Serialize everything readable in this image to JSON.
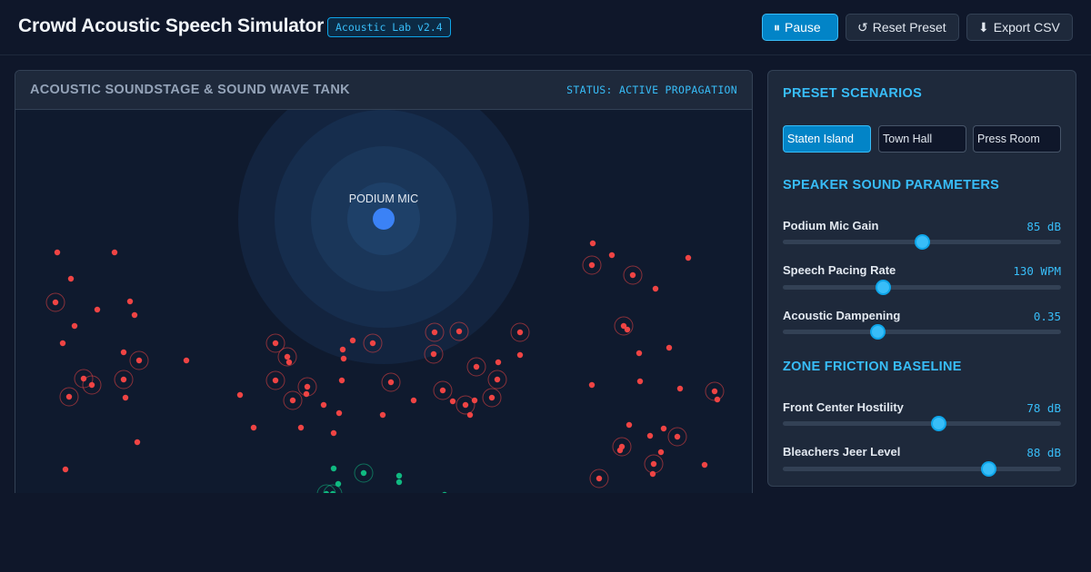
{
  "header": {
    "title": "Crowd Acoustic Speech Simulator",
    "version": "Acoustic Lab v2.4",
    "pause_label": "Pause",
    "pause_icon": "⏸",
    "reset_label": "Reset Preset",
    "reset_icon": "↺",
    "export_label": "Export CSV",
    "export_icon": "⬇"
  },
  "stage": {
    "title": "ACOUSTIC SOUNDSTAGE & SOUND WAVE TANK",
    "status": "STATUS: ACTIVE PROPAGATION",
    "mic_label": "PODIUM MIC",
    "colors": {
      "hostile": "#ef4444",
      "friendly": "#10b981",
      "mic": "#3b82f6",
      "wave": "#1e4a7a"
    }
  },
  "presets": {
    "title": "PRESET SCENARIOS",
    "items": [
      {
        "label": "Staten Island",
        "active": true
      },
      {
        "label": "Town Hall",
        "active": false
      },
      {
        "label": "Press Room",
        "active": false
      }
    ]
  },
  "speaker_params": {
    "title": "SPEAKER SOUND PARAMETERS",
    "items": [
      {
        "label": "Podium Mic Gain",
        "value": "85 dB",
        "level": 0.5
      },
      {
        "label": "Speech Pacing Rate",
        "value": "130 WPM",
        "level": 0.36
      },
      {
        "label": "Acoustic Dampening",
        "value": "0.35",
        "level": 0.34
      }
    ]
  },
  "zone_params": {
    "title": "ZONE FRICTION BASELINE",
    "items": [
      {
        "label": "Front Center Hostility",
        "value": "78 dB",
        "level": 0.56
      },
      {
        "label": "Bleachers Jeer Level",
        "value": "88 dB",
        "level": 0.74
      }
    ]
  }
}
